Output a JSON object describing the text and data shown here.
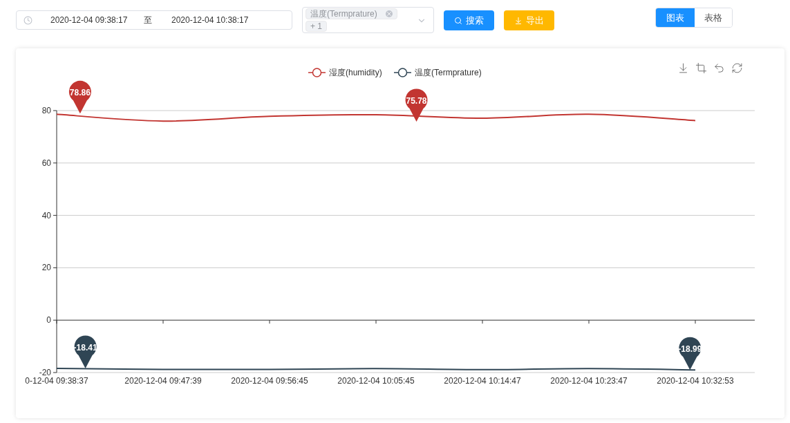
{
  "filter": {
    "start": "2020-12-04 09:38:17",
    "separator": "至",
    "end": "2020-12-04 10:38:17"
  },
  "select": {
    "tags": [
      "温度(Termprature)"
    ],
    "more": "+ 1"
  },
  "buttons": [
    {
      "kind": "search",
      "label": "搜索"
    },
    {
      "kind": "export",
      "label": "导出"
    }
  ],
  "view_tabs": [
    {
      "label": "图表",
      "selected": true
    },
    {
      "label": "表格",
      "selected": false
    }
  ],
  "chart": {
    "chart_data": {
      "type": "line",
      "categories": [
        "0-12-04 09:38:37",
        "2020-12-04 09:47:39",
        "2020-12-04 09:56:45",
        "2020-12-04 10:05:45",
        "2020-12-04 10:14:47",
        "2020-12-04 10:23:47",
        "2020-12-04 10:32:53"
      ],
      "series": [
        {
          "name": "湿度(humidity)",
          "color": "#c23531",
          "values": [
            78.6,
            76.0,
            77.8,
            78.4,
            77.1,
            78.6,
            76.2
          ]
        },
        {
          "name": "温度(Termprature)",
          "color": "#2f4554",
          "values": [
            -18.4,
            -18.8,
            -18.8,
            -18.5,
            -18.9,
            -18.5,
            -19.0
          ]
        }
      ],
      "ylim": [
        -20,
        80
      ],
      "yticks": [
        -20,
        0,
        20,
        40,
        60,
        80
      ],
      "grid": true,
      "legend": "top"
    },
    "markers": [
      [
        "78.86",
        "75.78"
      ],
      [
        "-18.41",
        "-18.99"
      ]
    ]
  }
}
